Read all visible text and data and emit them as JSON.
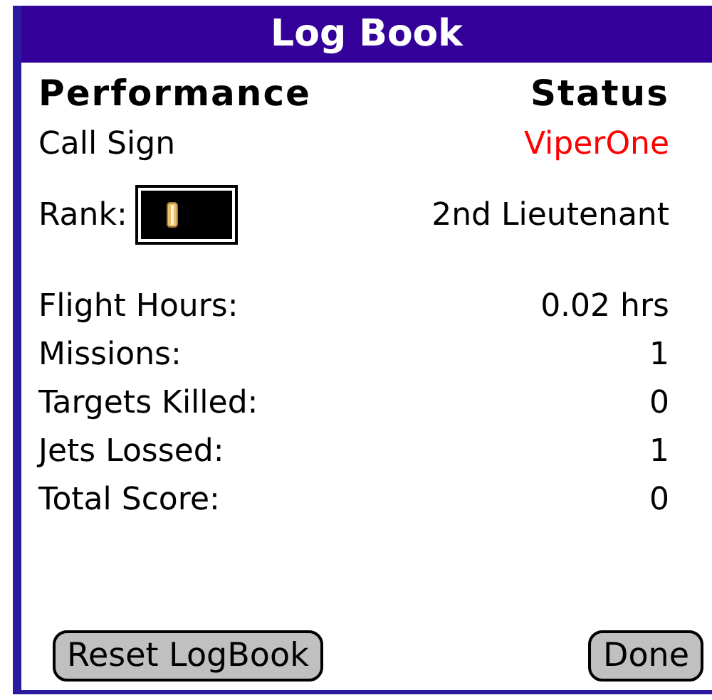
{
  "window": {
    "title": "Log Book"
  },
  "header": {
    "left": "Performance",
    "right": "Status"
  },
  "call_sign": {
    "label": "Call Sign",
    "value": "ViperOne"
  },
  "rank": {
    "label": "Rank:",
    "value": "2nd Lieutenant"
  },
  "stats": [
    {
      "label": "Flight Hours:",
      "value": "0.02 hrs"
    },
    {
      "label": "Missions:",
      "value": "1"
    },
    {
      "label": "Targets Killed:",
      "value": "0"
    },
    {
      "label": "Jets Lossed:",
      "value": "1"
    },
    {
      "label": "Total Score:",
      "value": "0"
    }
  ],
  "buttons": [
    "Reset LogBook",
    "Done"
  ]
}
